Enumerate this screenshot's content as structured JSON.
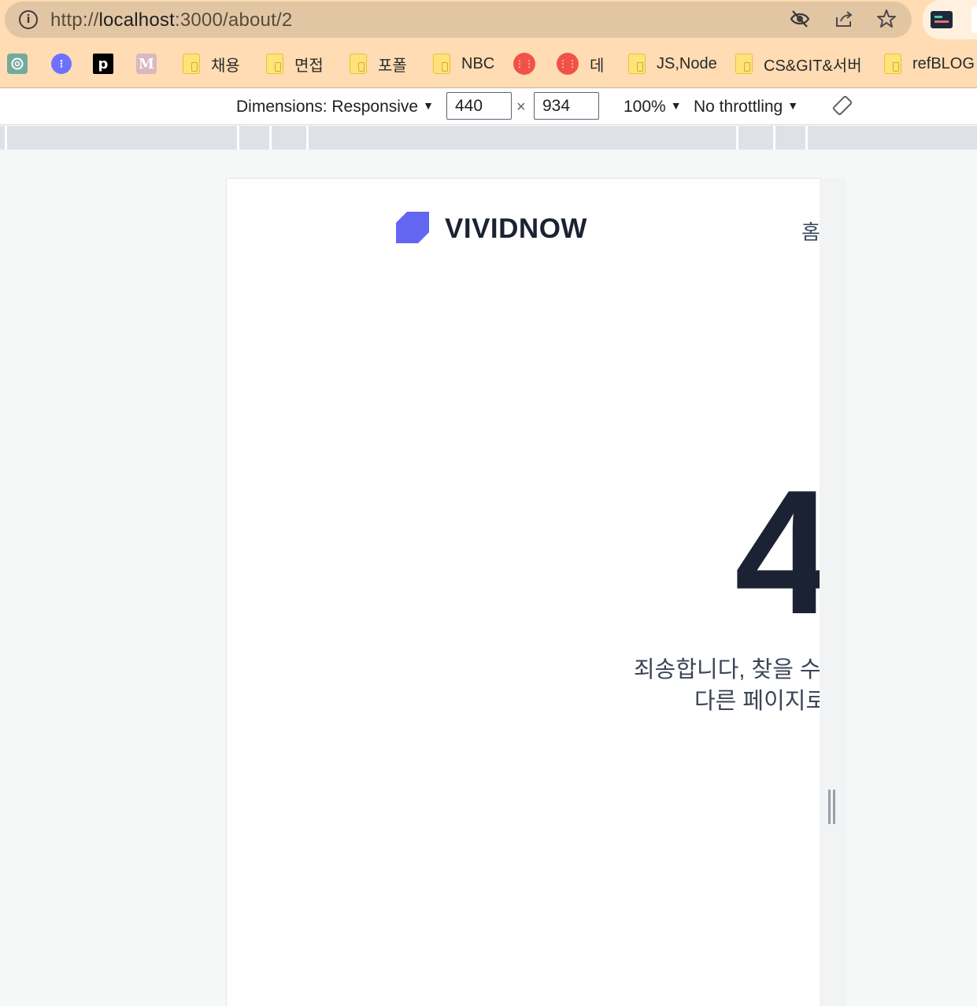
{
  "browser": {
    "url_prefix": "http://",
    "url_host": "localhost",
    "url_path": ":3000/about/2",
    "icons": [
      "info-icon",
      "eye-off-icon",
      "share-icon",
      "star-icon",
      "extension-icon"
    ]
  },
  "bookmarks": {
    "items": [
      {
        "label": "",
        "icon": "chatgpt-icon"
      },
      {
        "label": "",
        "icon": "app-icon"
      },
      {
        "label": "",
        "icon": "p-icon",
        "glyph": "p"
      },
      {
        "label": "",
        "icon": "medium-icon",
        "glyph": "M"
      },
      {
        "label": "채용",
        "icon": "folder-icon"
      },
      {
        "label": "면접",
        "icon": "folder-icon"
      },
      {
        "label": "포폴",
        "icon": "folder-icon"
      },
      {
        "label": "NBC",
        "icon": "folder-icon"
      },
      {
        "label": "",
        "icon": "red-dots-icon"
      },
      {
        "label": "데",
        "icon": "red-dots-icon"
      },
      {
        "label": "JS,Node",
        "icon": "folder-icon"
      },
      {
        "label": "CS&GIT&서버",
        "icon": "folder-icon"
      },
      {
        "label": "refBLOG",
        "icon": "folder-icon"
      }
    ]
  },
  "devtools": {
    "dimensions_label": "Dimensions: Responsive",
    "width_value": "440",
    "height_value": "934",
    "times_symbol": "×",
    "zoom_label": "100%",
    "throttle_label": "No throttling",
    "arrow": "▼"
  },
  "page": {
    "brand": "VIVIDNOW",
    "nav_home": "홈",
    "error_code": "4",
    "message_line1": "죄송합니다, 찾을 수",
    "message_line2": "다른 페이지로",
    "colors": {
      "logo": "#6366f1",
      "heading": "#1b2233",
      "text": "#3b4556"
    }
  }
}
